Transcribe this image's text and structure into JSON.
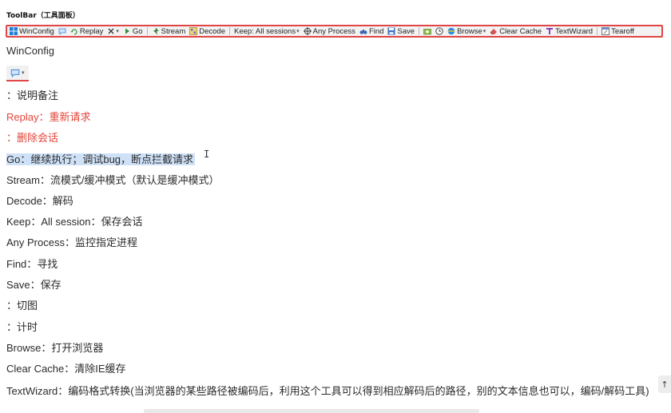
{
  "doc": {
    "title": "ToolBar（工具面板）"
  },
  "toolbar": {
    "winconfig": "WinConfig",
    "replay": "Replay",
    "go": "Go",
    "stream": "Stream",
    "decode": "Decode",
    "keep": "Keep: All sessions",
    "any_process": "Any Process",
    "find": "Find",
    "save": "Save",
    "browse": "Browse",
    "clear_cache": "Clear Cache",
    "textwizard": "TextWizard",
    "tearoff": "Tearoff"
  },
  "content": {
    "winconfig_heading": "WinConfig",
    "comment_line": "：说明备注",
    "replay_line": "Replay：重新请求",
    "remove_line": "：删除会话",
    "go_line": "Go：继续执行；调试bug，断点拦截请求",
    "stream_line": "Stream：流模式/缓冲模式（默认是缓冲模式）",
    "decode_line": "Decode：解码",
    "keep_line": "Keep：All session：保存会话",
    "any_process_line": "Any Process：监控指定进程",
    "find_line": "Find：寻找",
    "save_line": "Save：保存",
    "screenshot_line": "：切图",
    "timer_line": "：计时",
    "browse_line": "Browse：打开浏览器",
    "clear_cache_line": "Clear Cache：清除IE缓存",
    "textwizard_line": "TextWizard：编码格式转换(当浏览器的某些路径被编码后，利用这个工具可以得到相应解码后的路径，别的文本信息也可以，编码/解码工具)"
  },
  "colors": {
    "accent_red": "#e2453a",
    "highlight": "#cfe1f7",
    "toolbar_border": "#e04646"
  },
  "icons": {
    "scroll_top": "↑"
  }
}
